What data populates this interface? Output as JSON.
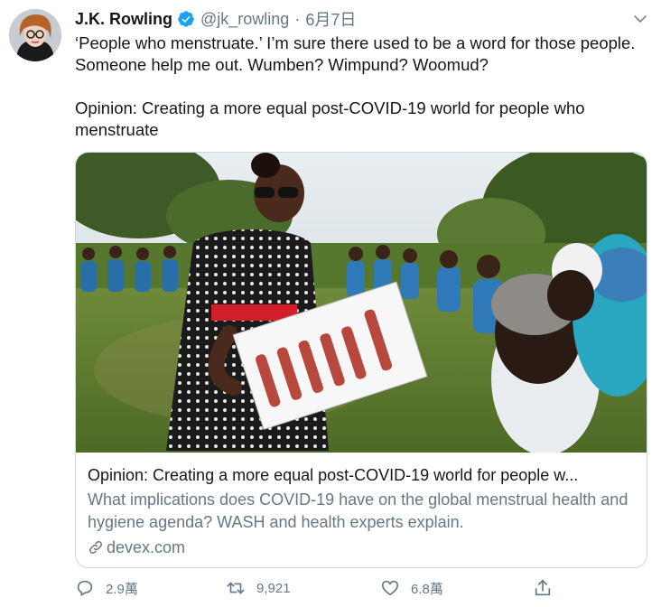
{
  "tweet": {
    "author_name": "J.K. Rowling",
    "handle": "@jk_rowling",
    "separator": "·",
    "date": "6月7日",
    "text_line1": "‘People who menstruate.’ I’m sure there used to be a word for those people. Someone help me out. Wumben? Wimpund? Woomud?",
    "text_line2": "Opinion: Creating a more equal post-COVID-19 world for people who menstruate"
  },
  "card": {
    "title": "Opinion: Creating a more equal post-COVID-19 world for people w...",
    "description": "What implications does COVID-19 have on the global menstrual health and hygiene agenda? WASH and health experts explain.",
    "domain": "devex.com"
  },
  "actions": {
    "reply_count": "2.9萬",
    "retweet_count": "9,921",
    "like_count": "6.8萬"
  },
  "icons": {
    "verified": "verified-badge-icon",
    "menu": "chevron-down-icon",
    "link": "link-icon",
    "reply": "reply-icon",
    "retweet": "retweet-icon",
    "like": "heart-icon",
    "share": "share-icon"
  },
  "colors": {
    "accent": "#1da1f2",
    "text": "#14171a",
    "secondary": "#657786",
    "border": "#ccd6dd"
  }
}
